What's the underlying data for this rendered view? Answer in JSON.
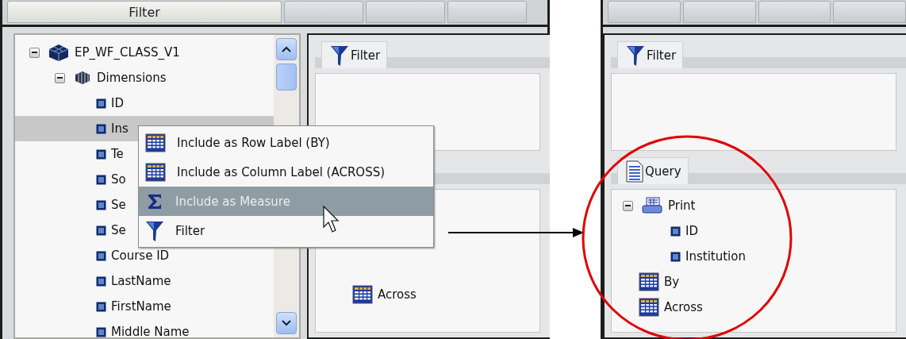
{
  "left_window": {
    "tabs": [
      {
        "label": "Filter",
        "selected": true
      }
    ],
    "tree": [
      {
        "label": "EP_WF_CLASS_V1",
        "kind": "cube",
        "expanded": true,
        "selected": false,
        "children": [
          {
            "label": "Dimensions",
            "kind": "dimensions",
            "expanded": true,
            "selected": false,
            "children": [
              {
                "label": "ID",
                "kind": "field",
                "selected": false
              },
              {
                "label": "Ins",
                "kind": "field",
                "selected": true
              },
              {
                "label": "Te",
                "kind": "field",
                "selected": false
              },
              {
                "label": "So",
                "kind": "field",
                "selected": false
              },
              {
                "label": "Se",
                "kind": "field",
                "selected": false
              },
              {
                "label": "Se",
                "kind": "field",
                "selected": false
              },
              {
                "label": "Course ID",
                "kind": "field",
                "selected": false
              },
              {
                "label": "LastName",
                "kind": "field",
                "selected": false
              },
              {
                "label": "FirstName",
                "kind": "field",
                "selected": false
              },
              {
                "label": "Middle Name",
                "kind": "field",
                "selected": false
              }
            ]
          }
        ]
      }
    ],
    "query_pane": {
      "filter_group": {
        "title": "Filter"
      },
      "query_group": {
        "items": [
          {
            "label": "Across",
            "kind": "across"
          }
        ]
      }
    },
    "context_menu": [
      {
        "label": "Include as Row Label (BY)",
        "kind": "row",
        "selected": false
      },
      {
        "label": "Include as Column Label (ACROSS)",
        "kind": "column",
        "selected": false
      },
      {
        "label": "Include as Measure",
        "kind": "measure",
        "selected": true
      },
      {
        "label": "Filter",
        "kind": "filter",
        "selected": false
      }
    ]
  },
  "right_window": {
    "query_pane": {
      "filter_group": {
        "title": "Filter"
      },
      "query_group": {
        "title": "Query",
        "tree": [
          {
            "label": "Print",
            "kind": "print",
            "expanded": true,
            "children": [
              {
                "label": "ID",
                "kind": "field"
              },
              {
                "label": "Institution",
                "kind": "field"
              }
            ]
          },
          {
            "label": "By",
            "kind": "by"
          },
          {
            "label": "Across",
            "kind": "across"
          }
        ]
      }
    }
  }
}
